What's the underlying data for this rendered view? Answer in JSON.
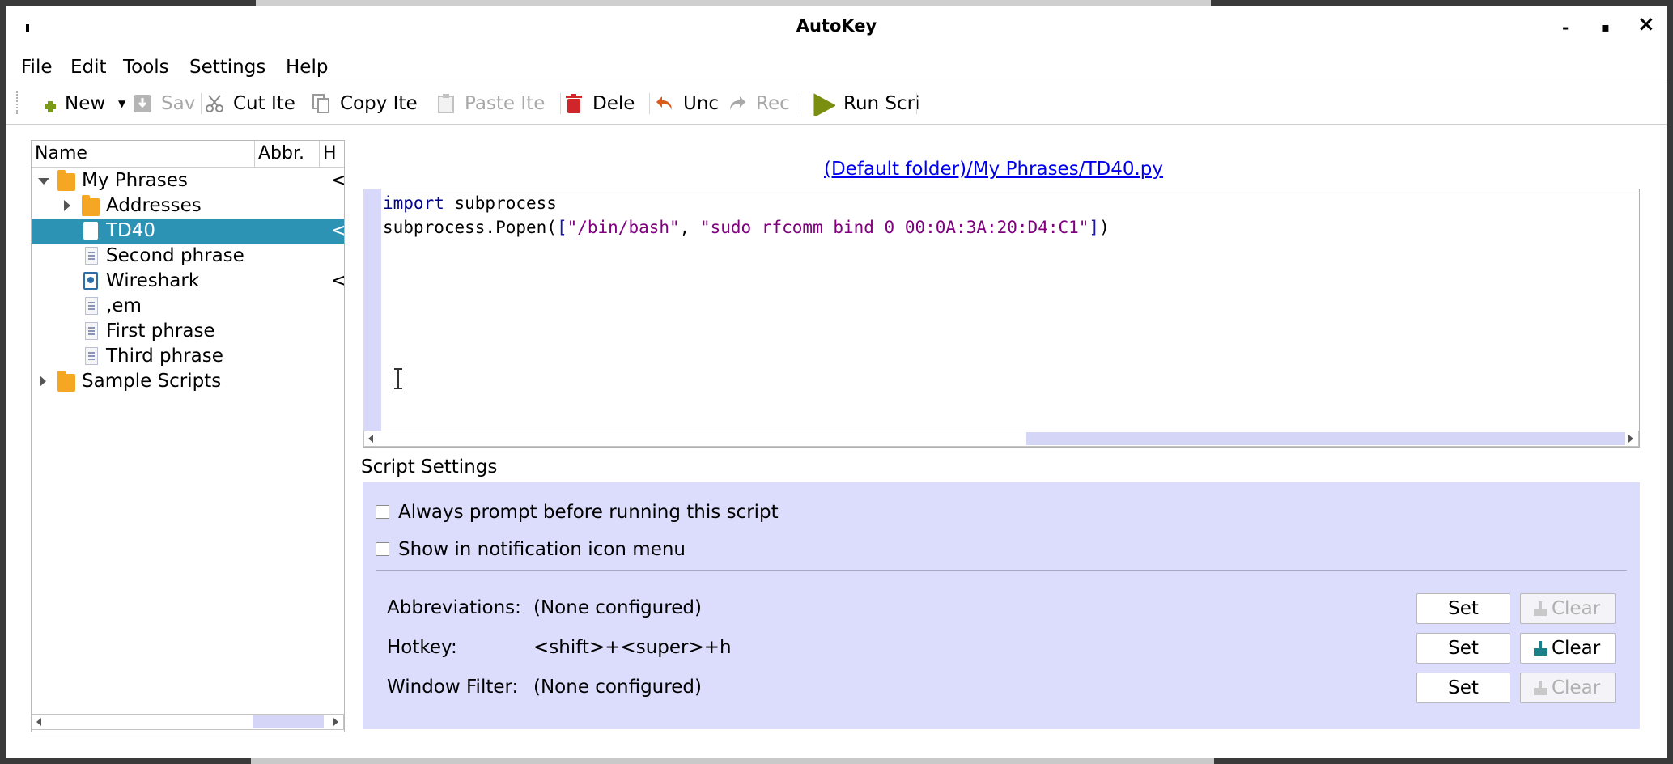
{
  "window": {
    "title": "AutoKey",
    "minimize": "-",
    "maximize": "▪",
    "close": "×"
  },
  "menu": [
    "File",
    "Edit",
    "Tools",
    "Settings",
    "Help"
  ],
  "toolbar": {
    "new": "New",
    "save": "Sa​v",
    "cut": "Cut Ite",
    "copy": "Copy Ite",
    "paste": "Paste Ite",
    "delete": "Dele",
    "undo": "Unc",
    "redo": "Rec",
    "run": "Run Scri"
  },
  "tree": {
    "columns": [
      "Name",
      "Abbr.",
      "H"
    ],
    "items": [
      {
        "name": "My Phrases",
        "hotkey": "<"
      },
      {
        "name": "Addresses",
        "hotkey": ""
      },
      {
        "name": "TD40",
        "hotkey": "<"
      },
      {
        "name": "Second phrase",
        "hotkey": ""
      },
      {
        "name": "Wireshark",
        "hotkey": "<"
      },
      {
        "name": ",em",
        "hotkey": ""
      },
      {
        "name": "First phrase",
        "hotkey": ""
      },
      {
        "name": "Third phrase",
        "hotkey": ""
      },
      {
        "name": "Sample Scripts",
        "hotkey": ""
      }
    ]
  },
  "editor": {
    "path": "(Default folder)/My Phrases/TD40.py",
    "line1_kw": "import",
    "line1_rest": " subprocess",
    "line2_call": "subprocess.Popen(",
    "line2_open": "[",
    "line2_arg1": "\"/bin/bash\"",
    "line2_comma": ", ",
    "line2_arg2": "\"sudo rfcomm bind 0 00:0A:3A:20:D4:C1\"",
    "line2_close": "]",
    "line2_end": ")"
  },
  "settings": {
    "title": "Script Settings",
    "always_prompt": "Always prompt before running this script",
    "show_notification": "Show in notification icon menu",
    "abbreviations_label": "Abbreviations:",
    "abbreviations_value": "(None configured)",
    "hotkey_label": "Hotkey:",
    "hotkey_value": "<shift>+<super>+h",
    "window_filter_label": "Window Filter:",
    "window_filter_value": "(None configured)",
    "set_label": "Set",
    "clear_label": "Clear"
  }
}
